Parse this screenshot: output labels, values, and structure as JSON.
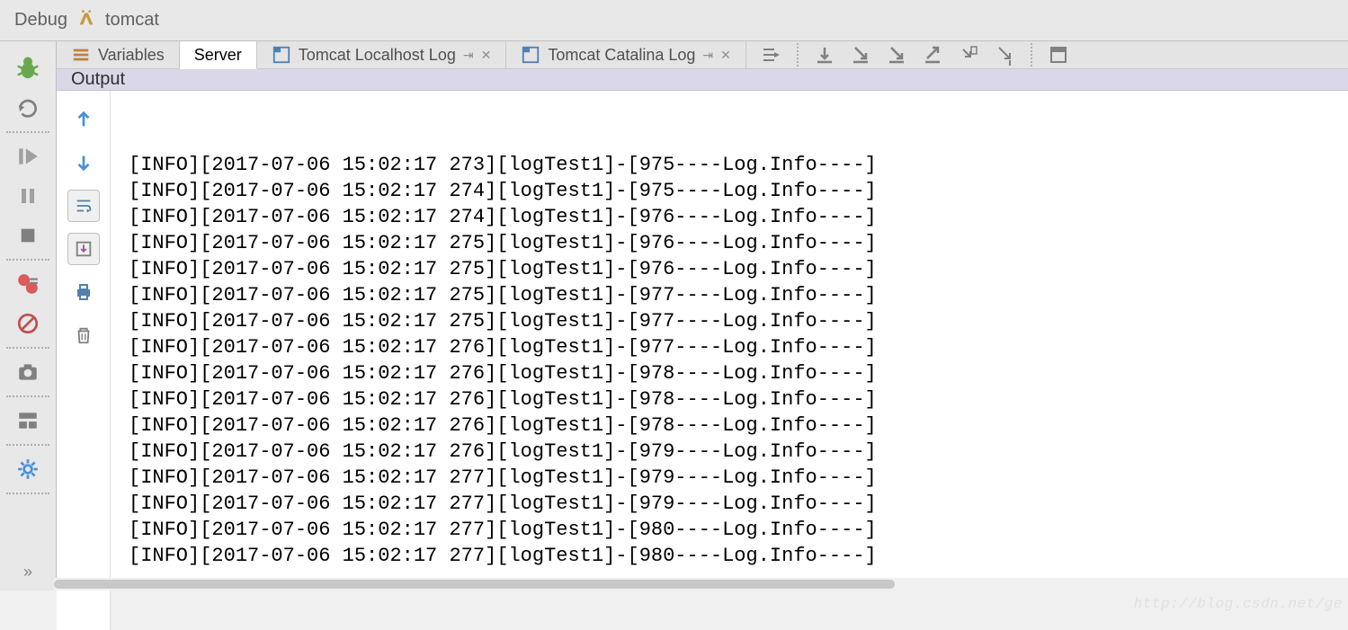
{
  "header": {
    "title": "Debug",
    "config": "tomcat"
  },
  "tabs": {
    "variables": "Variables",
    "server": "Server",
    "localhost_log": "Tomcat Localhost Log",
    "catalina_log": "Tomcat Catalina Log"
  },
  "output": {
    "title": "Output"
  },
  "log_lines": [
    "[INFO][2017-07-06 15:02:17 273][logTest1]-[975----Log.Info----]",
    "[INFO][2017-07-06 15:02:17 274][logTest1]-[975----Log.Info----]",
    "[INFO][2017-07-06 15:02:17 274][logTest1]-[976----Log.Info----]",
    "[INFO][2017-07-06 15:02:17 275][logTest1]-[976----Log.Info----]",
    "[INFO][2017-07-06 15:02:17 275][logTest1]-[976----Log.Info----]",
    "[INFO][2017-07-06 15:02:17 275][logTest1]-[977----Log.Info----]",
    "[INFO][2017-07-06 15:02:17 275][logTest1]-[977----Log.Info----]",
    "[INFO][2017-07-06 15:02:17 276][logTest1]-[977----Log.Info----]",
    "[INFO][2017-07-06 15:02:17 276][logTest1]-[978----Log.Info----]",
    "[INFO][2017-07-06 15:02:17 276][logTest1]-[978----Log.Info----]",
    "[INFO][2017-07-06 15:02:17 276][logTest1]-[978----Log.Info----]",
    "[INFO][2017-07-06 15:02:17 276][logTest1]-[979----Log.Info----]",
    "[INFO][2017-07-06 15:02:17 277][logTest1]-[979----Log.Info----]",
    "[INFO][2017-07-06 15:02:17 277][logTest1]-[979----Log.Info----]",
    "[INFO][2017-07-06 15:02:17 277][logTest1]-[980----Log.Info----]",
    "[INFO][2017-07-06 15:02:17 277][logTest1]-[980----Log.Info----]"
  ],
  "watermark": "http://blog.csdn.net/ge"
}
